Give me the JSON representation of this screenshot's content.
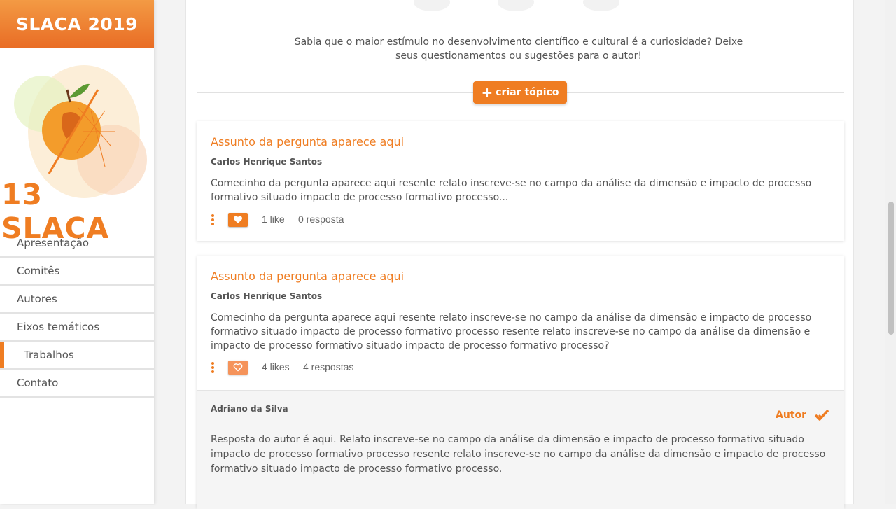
{
  "sidebar": {
    "brand": "SLACA 2019",
    "logo_text": "13 SLACA",
    "items": [
      {
        "label": "Apresentação"
      },
      {
        "label": "Comitês"
      },
      {
        "label": "Autores"
      },
      {
        "label": "Eixos temáticos"
      },
      {
        "label": "Trabalhos",
        "active": true
      },
      {
        "label": "Contato"
      }
    ]
  },
  "main": {
    "intro": "Sabia que o maior estímulo no desenvolvimento científico e cultural é a curiosidade? Deixe seus questionamentos ou sugestões para o autor!",
    "create_button": "criar tópico",
    "topics": [
      {
        "title": "Assunto da pergunta aparece aqui",
        "author": "Carlos Henrique Santos",
        "body": "Comecinho da pergunta aparece aqui resente relato inscreve-se no campo da análise da dimensão e impacto de processo formativo situado impacto de processo formativo processo...",
        "likes": "1 like",
        "replies": "0 resposta"
      },
      {
        "title": "Assunto da pergunta aparece aqui",
        "author": "Carlos Henrique Santos",
        "body": "Comecinho da pergunta aparece aqui resente relato inscreve-se no campo da análise da dimensão e impacto de processo formativo situado impacto de processo formativo processo resente relato inscreve-se no campo da análise da dimensão e impacto de processo formativo situado impacto de processo formativo processo?",
        "likes": "4 likes",
        "replies": "4 respostas"
      }
    ],
    "reply": {
      "author": "Adriano da Silva",
      "badge": "Autor",
      "body": "Resposta do autor é aqui. Relato inscreve-se no campo da análise da dimensão e impacto de processo formativo situado impacto de processo formativo processo resente relato inscreve-se no campo da análise da dimensão e impacto de processo formativo situado impacto de processo formativo processo."
    }
  },
  "colors": {
    "accent": "#ef7d22",
    "text": "#555555"
  },
  "icons": [
    "plus-icon",
    "more-vertical-icon",
    "heart-icon",
    "check-icon"
  ]
}
